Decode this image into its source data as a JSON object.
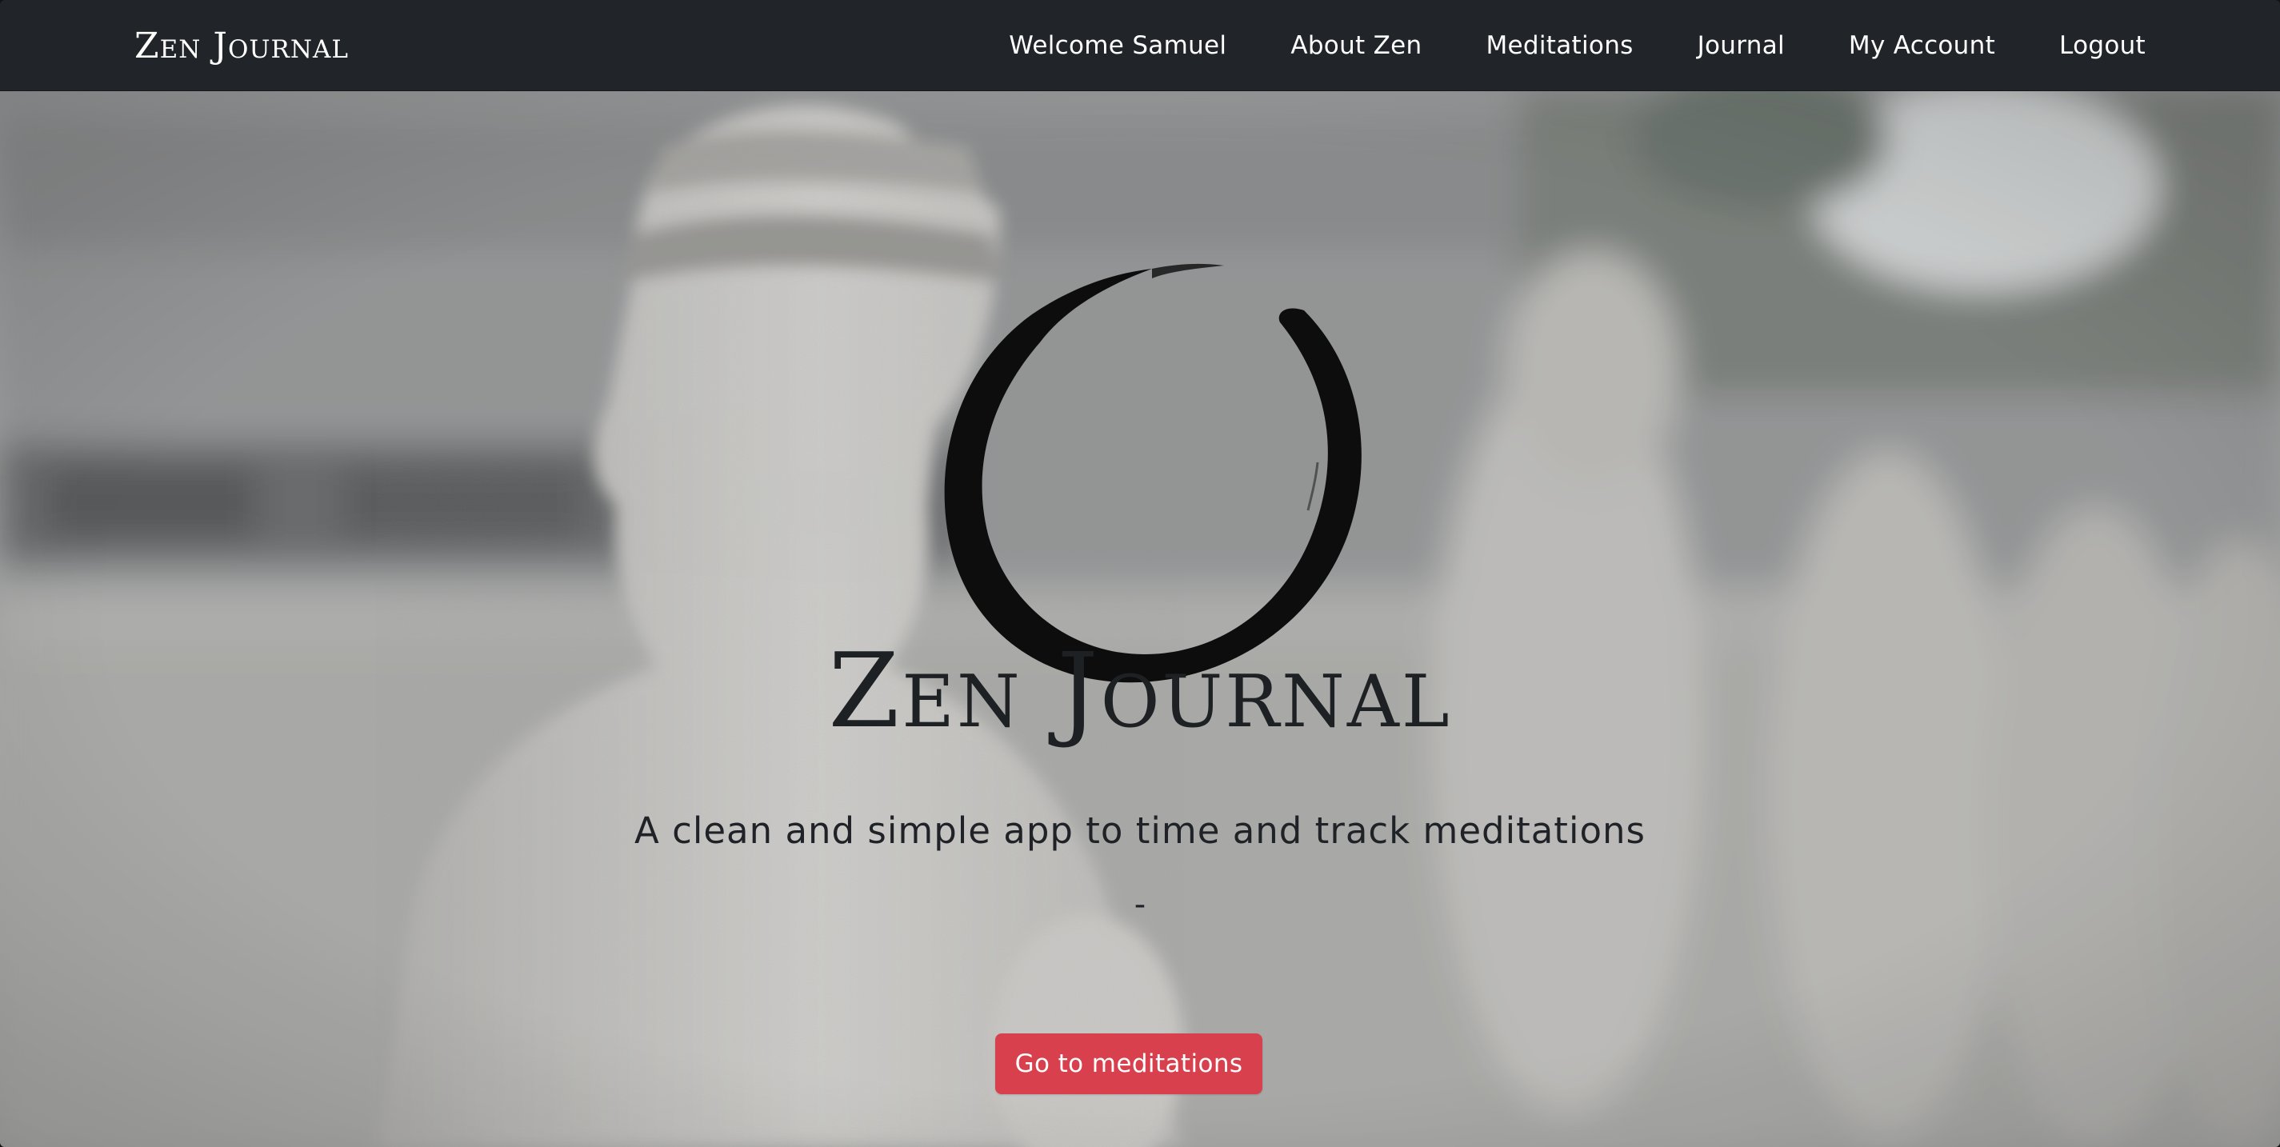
{
  "navbar": {
    "brand": "Zen Journal",
    "links": [
      {
        "label": "Welcome Samuel"
      },
      {
        "label": "About Zen"
      },
      {
        "label": "Meditations"
      },
      {
        "label": "Journal"
      },
      {
        "label": "My Account"
      },
      {
        "label": "Logout"
      }
    ]
  },
  "hero": {
    "logo_icon": "enso-circle-icon",
    "title": "Zen Journal",
    "subtitle": "A clean and simple app to time and track meditations",
    "separator": "-",
    "cta_label": "Go to meditations",
    "background_image": "stone buddha statues"
  },
  "colors": {
    "navbar_bg": "#212529",
    "cta_bg": "#d9404d",
    "title_text": "#1e2124"
  }
}
